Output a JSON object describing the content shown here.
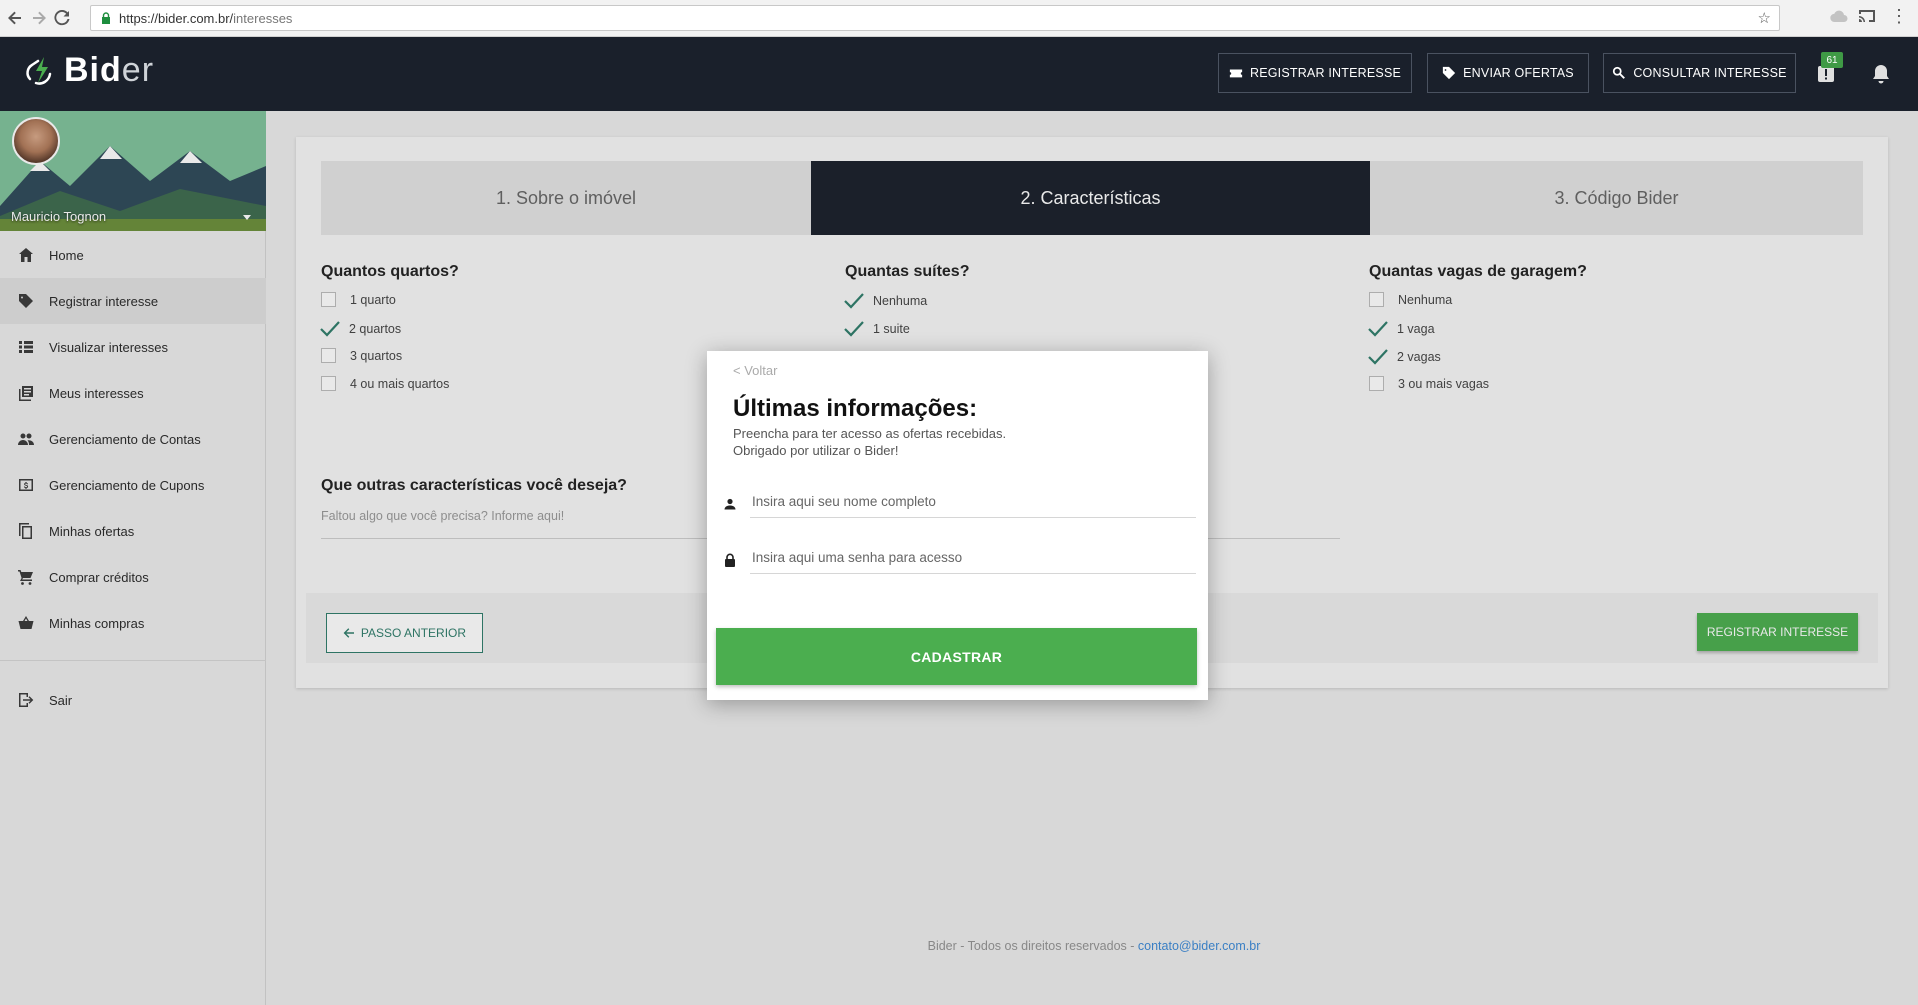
{
  "browser": {
    "url_host": "https://bider.com.br/",
    "url_path": "interesses"
  },
  "header": {
    "brand_bold": "Bid",
    "brand_light": "er",
    "buttons": {
      "registrar": "REGISTRAR INTERESSE",
      "enviar": "ENVIAR OFERTAS",
      "consultar": "CONSULTAR INTERESSE"
    },
    "notification_count": "61"
  },
  "sidebar": {
    "user_name": "Mauricio Tognon",
    "items": [
      {
        "label": "Home",
        "icon": "home-icon"
      },
      {
        "label": "Registrar interesse",
        "icon": "tag-icon"
      },
      {
        "label": "Visualizar interesses",
        "icon": "list-icon"
      },
      {
        "label": "Meus interesses",
        "icon": "library-icon"
      },
      {
        "label": "Gerenciamento de Contas",
        "icon": "people-icon"
      },
      {
        "label": "Gerenciamento de Cupons",
        "icon": "money-icon"
      },
      {
        "label": "Minhas ofertas",
        "icon": "copy-icon"
      },
      {
        "label": "Comprar créditos",
        "icon": "cart-icon"
      },
      {
        "label": "Minhas compras",
        "icon": "basket-icon"
      }
    ],
    "logout": "Sair"
  },
  "steps": [
    {
      "label": "1. Sobre o imóvel"
    },
    {
      "label": "2. Características"
    },
    {
      "label": "3. Código Bider"
    }
  ],
  "questions": {
    "quartos": {
      "title": "Quantos quartos?",
      "options": [
        {
          "label": "1 quarto",
          "checked": false
        },
        {
          "label": "2 quartos",
          "checked": true
        },
        {
          "label": "3 quartos",
          "checked": false
        },
        {
          "label": "4 ou mais quartos",
          "checked": false
        }
      ]
    },
    "suites": {
      "title": "Quantas suítes?",
      "options": [
        {
          "label": "Nenhuma",
          "checked": true
        },
        {
          "label": "1 suite",
          "checked": true
        }
      ]
    },
    "vagas": {
      "title": "Quantas vagas de garagem?",
      "options": [
        {
          "label": "Nenhuma",
          "checked": false
        },
        {
          "label": "1 vaga",
          "checked": true
        },
        {
          "label": "2 vagas",
          "checked": true
        },
        {
          "label": "3 ou mais vagas",
          "checked": false
        }
      ]
    },
    "outras": {
      "title": "Que outras características você deseja?",
      "placeholder": "Faltou algo que você precisa? Informe aqui!"
    }
  },
  "actions": {
    "previous": "PASSO ANTERIOR",
    "register": "REGISTRAR INTERESSE"
  },
  "footer": {
    "text": "Bider - Todos os direitos reservados - ",
    "email": "contato@bider.com.br"
  },
  "modal": {
    "back": "< Voltar",
    "title": "Últimas informações:",
    "subtitle_line1": "Preencha para ter acesso as ofertas recebidas.",
    "subtitle_line2": "Obrigado por utilizar o Bider!",
    "name_placeholder": "Insira aqui seu nome completo",
    "password_placeholder": "Insira aqui uma senha para acesso",
    "submit": "CADASTRAR"
  },
  "colors": {
    "header_bg": "#1a202b",
    "accent_green": "#4bae4f",
    "check_teal": "#2f7d6b"
  }
}
